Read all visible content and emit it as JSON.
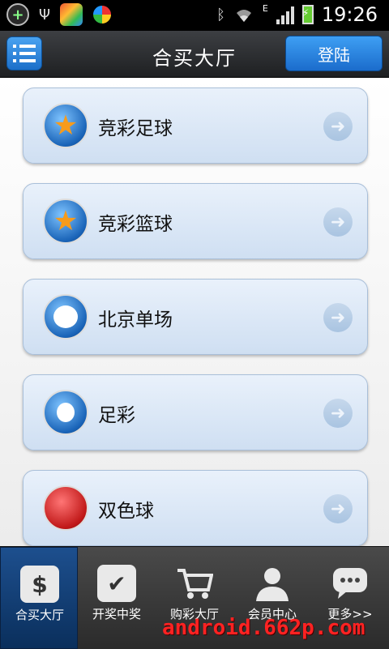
{
  "status_bar": {
    "time": "19:26",
    "network_type": "E",
    "icons": [
      "add-circle-icon",
      "usb-icon",
      "app-icon",
      "sync-app-icon",
      "bluetooth-icon",
      "wifi-icon",
      "signal-icon",
      "battery-charging-icon"
    ]
  },
  "header": {
    "title": "合买大厅",
    "login_label": "登陆",
    "menu_icon": "list-menu-icon"
  },
  "lottery_list": [
    {
      "label": "竞彩足球",
      "icon": "jingcai-football-icon"
    },
    {
      "label": "竞彩篮球",
      "icon": "jingcai-basketball-icon"
    },
    {
      "label": "北京单场",
      "icon": "beijing-single-icon"
    },
    {
      "label": "足彩",
      "icon": "football-lottery-icon"
    },
    {
      "label": "双色球",
      "icon": "double-color-ball-icon"
    }
  ],
  "bottom_nav": {
    "tabs": [
      {
        "label": "合买大厅",
        "icon": "dollar-list-icon",
        "active": true
      },
      {
        "label": "开奖中奖",
        "icon": "checkmark-icon",
        "active": false
      },
      {
        "label": "购彩大厅",
        "icon": "shopping-cart-icon",
        "active": false
      },
      {
        "label": "会员中心",
        "icon": "user-icon",
        "active": false
      },
      {
        "label": "更多>>",
        "icon": "chat-bubble-icon",
        "active": false
      }
    ]
  },
  "watermark": "android.662p.com",
  "colors": {
    "accent_blue": "#1c6fc9",
    "card_bg": "#dbe7f6",
    "watermark_red": "#ff2222"
  }
}
